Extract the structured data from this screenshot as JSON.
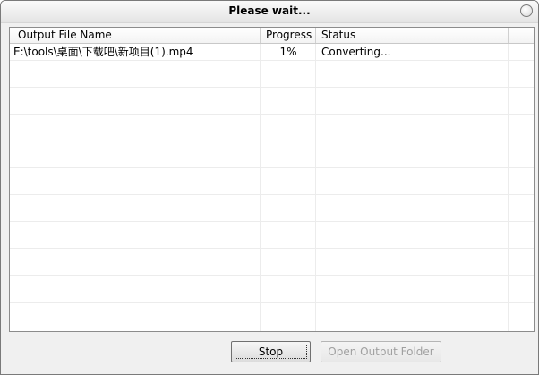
{
  "window": {
    "title": "Please wait..."
  },
  "table": {
    "columns": [
      "Output File Name",
      "Progress",
      "Status"
    ],
    "rows": [
      {
        "file": "E:\\tools\\桌面\\下载吧\\新项目(1).mp4",
        "progress": "1%",
        "status": "Converting..."
      }
    ]
  },
  "buttons": {
    "stop_label": "Stop",
    "open_folder_label": "Open Output Folder"
  }
}
